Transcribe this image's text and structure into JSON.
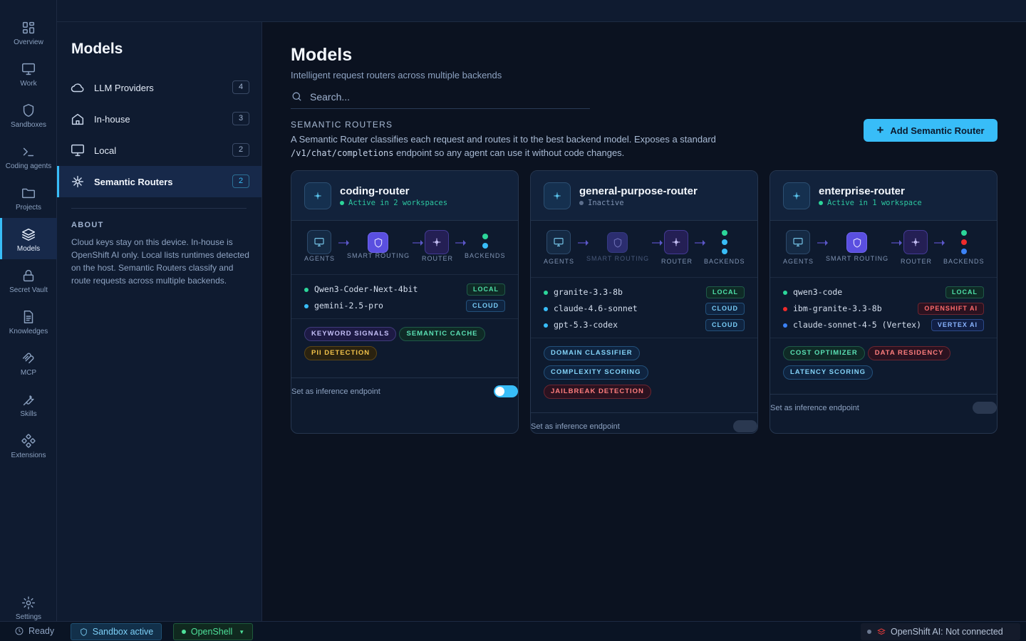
{
  "rail": [
    {
      "label": "Overview",
      "icon": "overview-icon"
    },
    {
      "label": "Work",
      "icon": "monitor-icon"
    },
    {
      "label": "Sandboxes",
      "icon": "shield-icon"
    },
    {
      "label": "Coding agents",
      "icon": "terminal-icon"
    },
    {
      "label": "Projects",
      "icon": "folder-icon"
    },
    {
      "label": "Models",
      "icon": "layers-icon",
      "active": true
    },
    {
      "label": "Secret Vault",
      "icon": "lock-icon"
    },
    {
      "label": "Knowledges",
      "icon": "document-icon"
    },
    {
      "label": "MCP",
      "icon": "mcp-icon"
    },
    {
      "label": "Skills",
      "icon": "wrench-icon"
    },
    {
      "label": "Extensions",
      "icon": "extensions-icon"
    },
    {
      "label": "Settings",
      "icon": "gear-icon"
    }
  ],
  "sidebar": {
    "title": "Models",
    "items": [
      {
        "label": "LLM Providers",
        "count": "4",
        "icon": "cloud-icon"
      },
      {
        "label": "In-house",
        "count": "3",
        "icon": "home-icon"
      },
      {
        "label": "Local",
        "count": "2",
        "icon": "monitor-icon"
      },
      {
        "label": "Semantic Routers",
        "count": "2",
        "icon": "sparkle-icon",
        "active": true
      }
    ],
    "about_heading": "ABOUT",
    "about_text": "Cloud keys stay on this device. In-house is OpenShift AI only. Local lists runtimes detected on the host. Semantic Routers classify and route requests across multiple backends."
  },
  "main": {
    "title": "Models",
    "subtitle": "Intelligent request routers across multiple backends",
    "search_placeholder": "Search...",
    "section_heading": "SEMANTIC ROUTERS",
    "section_desc_1": "A Semantic Router classifies each request and routes it to the best backend model. Exposes a standard ",
    "section_desc_code": "/v1/chat/completions",
    "section_desc_2": " endpoint so any agent can use it without code changes.",
    "add_button": "Add Semantic Router"
  },
  "flow_labels": {
    "agents": "AGENTS",
    "smart": "SMART ROUTING",
    "router": "ROUTER",
    "backends": "BACKENDS"
  },
  "routers": [
    {
      "name": "coding-router",
      "status": "Active in 2 workspaces",
      "active": true,
      "backend_dots": [
        "#2cd69a",
        "#38bdf8"
      ],
      "backends": [
        {
          "name": "Qwen3-Coder-Next-4bit",
          "tag": "LOCAL",
          "dot": "#2cd69a"
        },
        {
          "name": "gemini-2.5-pro",
          "tag": "CLOUD",
          "dot": "#38bdf8"
        }
      ],
      "chips": [
        {
          "label": "KEYWORD SIGNALS",
          "style": "purple"
        },
        {
          "label": "SEMANTIC CACHE",
          "style": "green"
        },
        {
          "label": "PII DETECTION",
          "style": "yellow"
        }
      ],
      "footer": "Set as inference endpoint",
      "inference_endpoint": true
    },
    {
      "name": "general-purpose-router",
      "status": "Inactive",
      "active": false,
      "backend_dots": [
        "#2cd69a",
        "#38bdf8",
        "#38bdf8"
      ],
      "backends": [
        {
          "name": "granite-3.3-8b",
          "tag": "LOCAL",
          "dot": "#2cd69a"
        },
        {
          "name": "claude-4.6-sonnet",
          "tag": "CLOUD",
          "dot": "#38bdf8"
        },
        {
          "name": "gpt-5.3-codex",
          "tag": "CLOUD",
          "dot": "#38bdf8"
        }
      ],
      "chips": [
        {
          "label": "DOMAIN CLASSIFIER",
          "style": "blue"
        },
        {
          "label": "COMPLEXITY SCORING",
          "style": "blue"
        },
        {
          "label": "JAILBREAK DETECTION",
          "style": "red"
        }
      ],
      "footer": "Set as inference endpoint",
      "inference_endpoint": false
    },
    {
      "name": "enterprise-router",
      "status": "Active in 1 workspace",
      "active": true,
      "backend_dots": [
        "#2cd69a",
        "#ef2b2b",
        "#3b82f6"
      ],
      "backends": [
        {
          "name": "qwen3-code",
          "tag": "LOCAL",
          "dot": "#2cd69a"
        },
        {
          "name": "ibm-granite-3.3-8b",
          "tag": "OPENSHIFT AI",
          "dot": "#ef2b2b"
        },
        {
          "name": "claude-sonnet-4-5 (Vertex)",
          "tag": "VERTEX AI",
          "dot": "#3b82f6"
        }
      ],
      "chips": [
        {
          "label": "COST OPTIMIZER",
          "style": "green"
        },
        {
          "label": "DATA RESIDENCY",
          "style": "red"
        },
        {
          "label": "LATENCY SCORING",
          "style": "blue"
        }
      ],
      "footer": "Set as inference endpoint",
      "inference_endpoint": false
    }
  ],
  "statusbar": {
    "ready": "Ready",
    "sandbox": "Sandbox active",
    "openshell": "OpenShell",
    "openshift": "OpenShift AI: Not connected"
  }
}
